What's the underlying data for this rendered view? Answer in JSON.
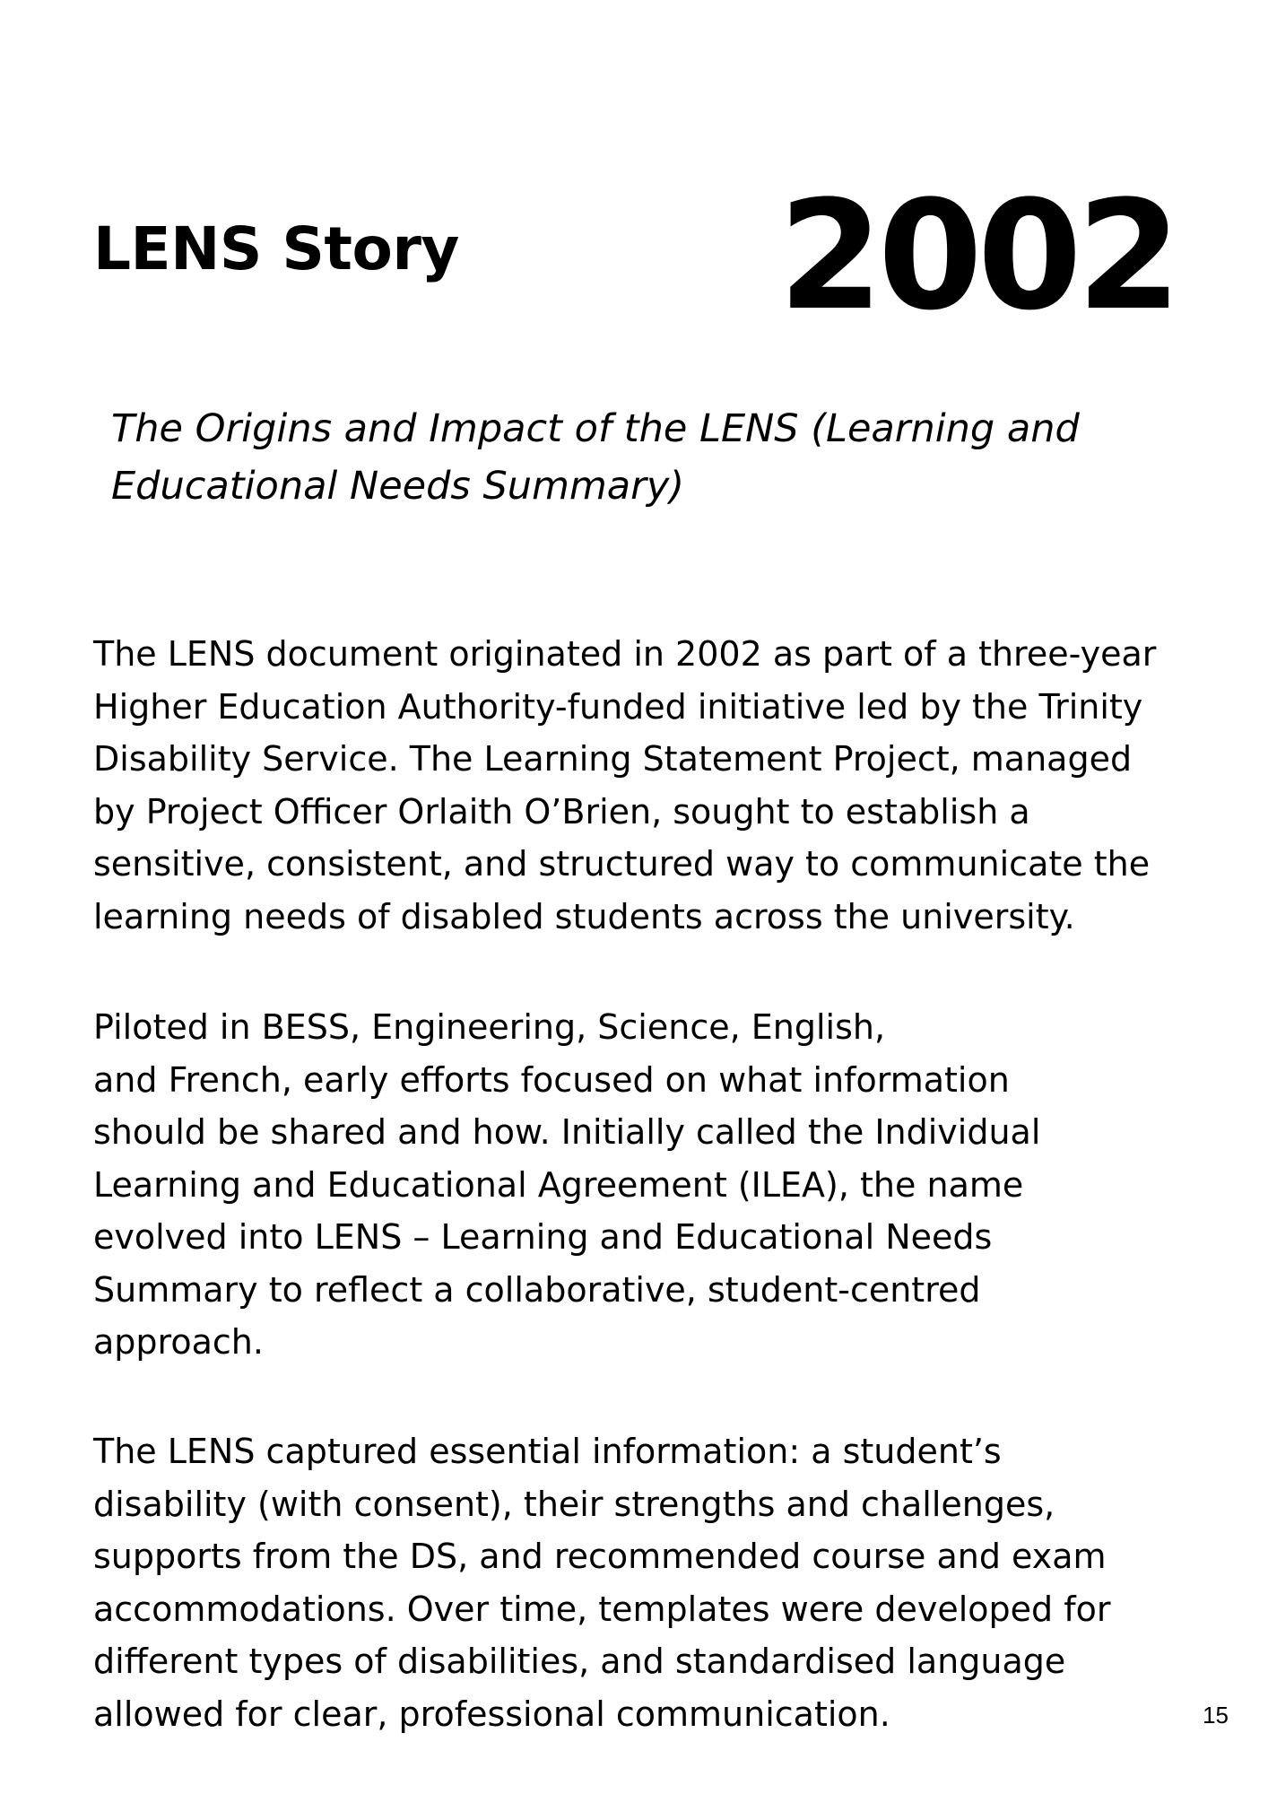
{
  "header": {
    "title": "LENS Story",
    "year": "2002"
  },
  "subtitle": "The Origins and Impact of the LENS (Learning and\nEducational Needs Summary)",
  "body": {
    "paragraphs": [
      "The LENS document originated in 2002 as part of a three-year\nHigher Education Authority-funded initiative led by the Trinity\nDisability Service. The Learning Statement Project, managed\nby Project Officer Orlaith O’Brien, sought to establish a\nsensitive, consistent, and structured way to communicate the\nlearning needs of disabled students across the university.",
      "Piloted in BESS, Engineering, Science, English,\n and French, early efforts focused on what information\nshould be shared and how. Initially called the Individual\nLearning and Educational Agreement (ILEA), the name\nevolved into LENS – Learning and Educational Needs\nSummary to reflect a collaborative, student-centred\napproach.",
      "The LENS captured essential information: a student’s\ndisability (with consent), their strengths and challenges,\nsupports from the DS, and recommended course and exam\naccommodations. Over time, templates were developed for\ndifferent types of disabilities, and standardised language\nallowed for clear, professional communication."
    ]
  },
  "footer": {
    "page_number": "15"
  }
}
